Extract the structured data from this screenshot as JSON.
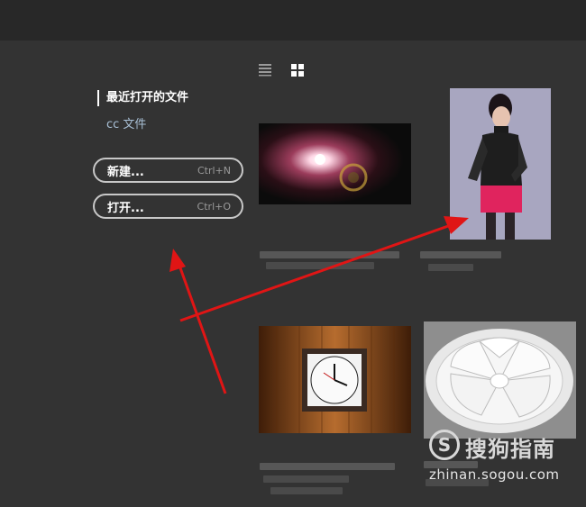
{
  "toolbar": {
    "list_view_icon": "list-view-icon",
    "grid_view_icon": "grid-view-icon"
  },
  "sidebar": {
    "recent_files": "最近打开的文件",
    "cc_files": "cc 文件"
  },
  "actions": {
    "new_label": "新建...",
    "new_shortcut": "Ctrl+N",
    "open_label": "打开...",
    "open_shortcut": "Ctrl+O"
  },
  "recent_thumbnails": [
    {
      "subject": "lens-flare"
    },
    {
      "subject": "fashion-model"
    },
    {
      "subject": "wall-clock"
    },
    {
      "subject": "ceramic-plate"
    }
  ],
  "colors": {
    "background": "#333333",
    "top_bar": "#282828",
    "arrow": "#e01515",
    "cc_link": "#a9c0d6"
  },
  "watermark": {
    "logo_letter": "S",
    "brand": "搜狗指南",
    "url": "zhinan.sogou.com"
  }
}
